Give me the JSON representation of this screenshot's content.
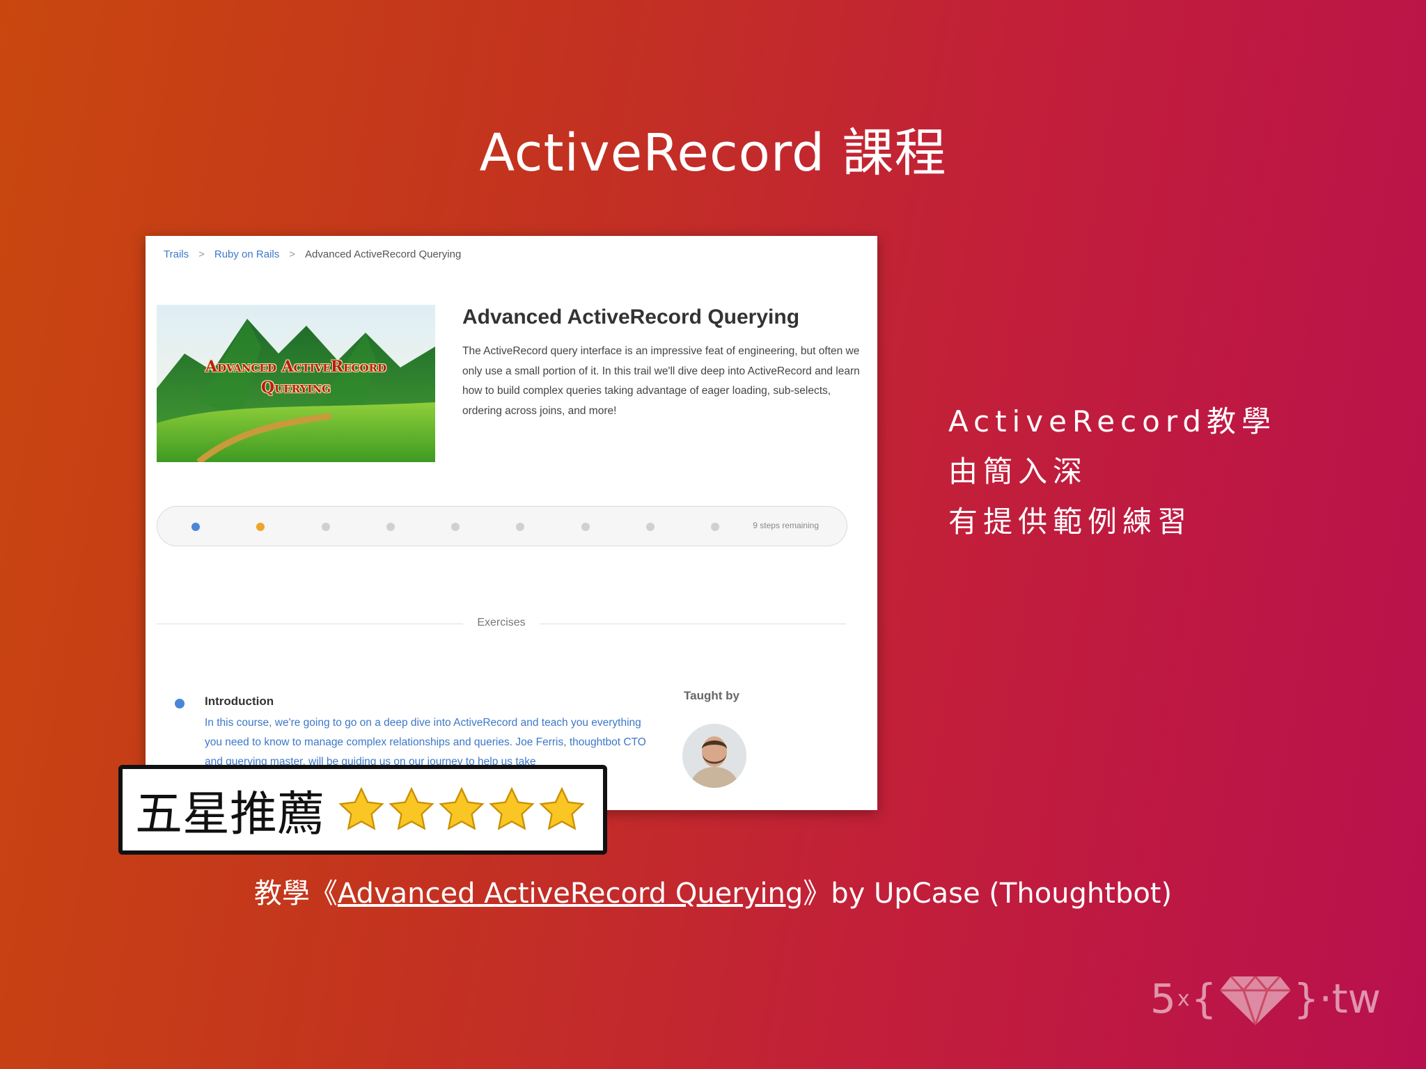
{
  "slide": {
    "title": "ActiveRecord 課程",
    "side_lines": [
      "ActiveRecord教學",
      "由簡入深",
      "有提供範例練習"
    ],
    "rating": {
      "label": "五星推薦",
      "stars": 5,
      "star_icon": "star-icon"
    },
    "caption": {
      "prefix": "教學《",
      "link": "Advanced ActiveRecord Querying",
      "suffix": "》by UpCase (Thoughtbot)"
    },
    "logo": {
      "left": "5",
      "times": "x",
      "open": "{",
      "close": "}",
      "dot": "·",
      "right": "tw",
      "icon": "gem-icon"
    }
  },
  "screenshot": {
    "breadcrumb": [
      "Trails",
      "Ruby on Rails",
      "Advanced ActiveRecord Querying"
    ],
    "breadcrumb_sep": ">",
    "cover_text": [
      "Advanced ActiveRecord",
      "Querying"
    ],
    "course_title": "Advanced ActiveRecord Querying",
    "course_desc": "The ActiveRecord query interface is an impressive feat of engineering, but often we only use a small portion of it. In this trail we'll dive deep into ActiveRecord and learn how to build complex queries taking advantage of eager loading, sub-selects, ordering across joins, and more!",
    "progress": {
      "total_steps": 9,
      "completed": 1,
      "current": 2,
      "remaining_label": "9 steps remaining"
    },
    "exercises_label": "Exercises",
    "intro": {
      "title": "Introduction",
      "text": "In this course, we're going to go on a deep dive into ActiveRecord and teach you everything you need to know to manage complex relationships and queries. Joe Ferris, thoughtbot CTO and querying master, will be guiding us on our journey to help us take"
    },
    "taught_by": "Taught by",
    "colors": {
      "link": "#3c78c9",
      "done": "#4a86d8",
      "current": "#f0a428",
      "pending": "#d0d0d0"
    }
  }
}
